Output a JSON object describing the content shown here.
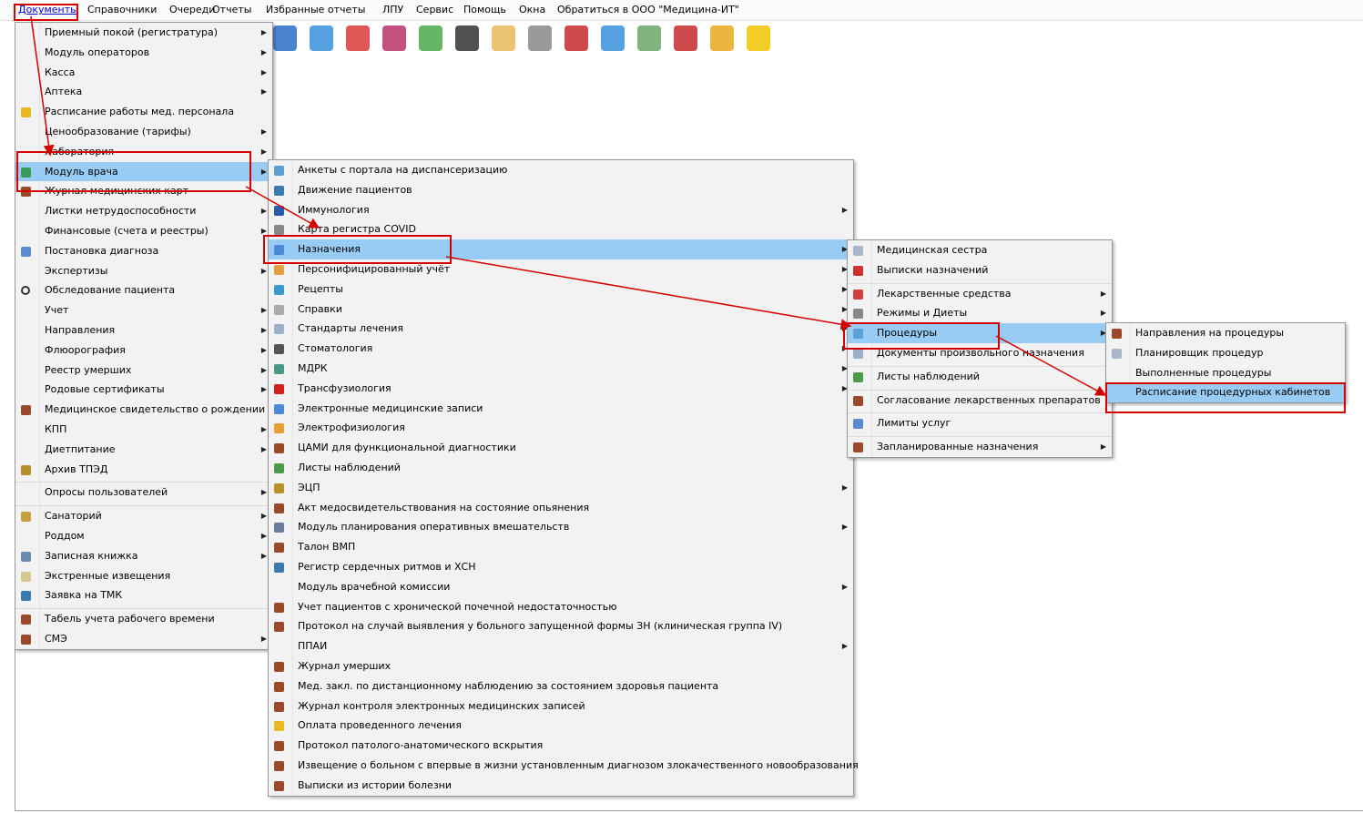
{
  "menubar": {
    "items": [
      "Документы",
      "Справочники",
      "Очереди",
      "Отчеты",
      "Избранные отчеты",
      "ЛПУ",
      "Сервис",
      "Помощь",
      "Окна",
      "Обратиться в ООО \"Медицина-ИТ\""
    ],
    "active": "Документы"
  },
  "toolbar": {
    "icons": [
      "clock-icon",
      "medicine-icon",
      "medkit-icon",
      "cubes-icon",
      "recycle-icon",
      "barcode-icon",
      "doctor-icon",
      "syringe-icon",
      "book-icon",
      "calendar-icon",
      "document-icon",
      "record-icon",
      "lock-icon",
      "chat-icon"
    ]
  },
  "menu1": {
    "items": [
      {
        "label": "Приемный покой (регистратура)",
        "submenu": true,
        "icon": ""
      },
      {
        "label": "Модуль операторов",
        "submenu": true,
        "icon": ""
      },
      {
        "label": "Касса",
        "submenu": true,
        "icon": ""
      },
      {
        "label": "Аптека",
        "submenu": true,
        "icon": ""
      },
      {
        "label": "Расписание работы мед. персонала",
        "submenu": false,
        "icon": "schedule-icon"
      },
      {
        "label": "Ценообразование (тарифы)",
        "submenu": true,
        "icon": ""
      },
      {
        "label": "Лаборатория",
        "submenu": true,
        "icon": ""
      },
      {
        "label": "Модуль врача",
        "submenu": true,
        "icon": "doctor-icon",
        "highlight": true
      },
      {
        "label": "Журнал медицинских карт",
        "submenu": false,
        "icon": "journal-icon"
      },
      {
        "label": "Листки нетрудоспособности",
        "submenu": true,
        "icon": ""
      },
      {
        "label": "Финансовые (счета и реестры)",
        "submenu": true,
        "icon": ""
      },
      {
        "label": "Постановка диагноза",
        "submenu": false,
        "icon": "diagnosis-icon"
      },
      {
        "label": "Экспертизы",
        "submenu": true,
        "icon": ""
      },
      {
        "label": "Обследование пациента",
        "submenu": false,
        "icon": "search-icon"
      },
      {
        "label": "Учет",
        "submenu": true,
        "icon": ""
      },
      {
        "label": "Направления",
        "submenu": true,
        "icon": ""
      },
      {
        "label": "Флюорография",
        "submenu": true,
        "icon": ""
      },
      {
        "label": "Реестр умерших",
        "submenu": true,
        "icon": ""
      },
      {
        "label": "Родовые сертификаты",
        "submenu": true,
        "icon": ""
      },
      {
        "label": "Медицинское свидетельство о рождении",
        "submenu": false,
        "icon": "journal-icon"
      },
      {
        "label": "КПП",
        "submenu": true,
        "icon": ""
      },
      {
        "label": "Диетпитание",
        "submenu": true,
        "icon": ""
      },
      {
        "label": "Архив ТПЭД",
        "submenu": false,
        "icon": "archive-icon"
      },
      {
        "label": "Опросы пользователей",
        "submenu": true,
        "icon": "",
        "sep": true
      },
      {
        "label": "Санаторий",
        "submenu": true,
        "icon": "home-icon",
        "sep": true
      },
      {
        "label": "Роддом",
        "submenu": true,
        "icon": ""
      },
      {
        "label": "Записная книжка",
        "submenu": true,
        "icon": "notebook-icon"
      },
      {
        "label": "Экстренные извещения",
        "submenu": false,
        "icon": "notice-icon"
      },
      {
        "label": "Заявка на ТМК",
        "submenu": false,
        "icon": "people-icon"
      },
      {
        "label": "Табель учета рабочего времени",
        "submenu": false,
        "icon": "journal-icon",
        "sep": true
      },
      {
        "label": "СМЭ",
        "submenu": true,
        "icon": "journal-icon"
      }
    ]
  },
  "menu2": {
    "items": [
      {
        "label": "Анкеты с портала на диспансеризацию",
        "submenu": false,
        "icon": "form-icon"
      },
      {
        "label": "Движение пациентов",
        "submenu": false,
        "icon": "people-icon"
      },
      {
        "label": "Иммунология",
        "submenu": true,
        "icon": "syringe-icon"
      },
      {
        "label": "Карта регистра COVID",
        "submenu": false,
        "icon": "clipboard-icon"
      },
      {
        "label": "Назначения",
        "submenu": true,
        "icon": "note-icon",
        "highlight": true
      },
      {
        "label": "Персонифицированный учёт",
        "submenu": true,
        "icon": "person-icon"
      },
      {
        "label": "Рецепты",
        "submenu": true,
        "icon": "prescription-icon"
      },
      {
        "label": "Справки",
        "submenu": true,
        "icon": "doc-icon"
      },
      {
        "label": "Стандарты лечения",
        "submenu": true,
        "icon": "list-icon"
      },
      {
        "label": "Стоматология",
        "submenu": true,
        "icon": "tooth-icon"
      },
      {
        "label": "МДРК",
        "submenu": true,
        "icon": "group-icon"
      },
      {
        "label": "Трансфузиология",
        "submenu": true,
        "icon": "blood-icon"
      },
      {
        "label": "Электронные медицинские записи",
        "submenu": false,
        "icon": "note-icon"
      },
      {
        "label": "Электрофизиология",
        "submenu": false,
        "icon": "chart-icon"
      },
      {
        "label": "ЦАМИ для функциональной диагностики",
        "submenu": false,
        "icon": "journal-icon"
      },
      {
        "label": "Листы наблюдений",
        "submenu": false,
        "icon": "sheet-icon"
      },
      {
        "label": "ЭЦП",
        "submenu": true,
        "icon": "archive-icon"
      },
      {
        "label": "Акт медосвидетельствования на состояние опьянения",
        "submenu": false,
        "icon": "journal-icon"
      },
      {
        "label": "Модуль планирования оперативных вмешательств",
        "submenu": true,
        "icon": "plan-icon"
      },
      {
        "label": "Талон ВМП",
        "submenu": false,
        "icon": "journal-icon"
      },
      {
        "label": "Регистр сердечных ритмов и ХСН",
        "submenu": false,
        "icon": "people-icon"
      },
      {
        "label": "Модуль врачебной комиссии",
        "submenu": true,
        "icon": ""
      },
      {
        "label": "Учет пациентов с хронической почечной недостаточностью",
        "submenu": false,
        "icon": "journal-icon"
      },
      {
        "label": "Протокол на случай выявления у больного запущенной формы ЗН (клиническая группа IV)",
        "submenu": false,
        "icon": "journal-icon"
      },
      {
        "label": "ППАИ",
        "submenu": true,
        "icon": ""
      },
      {
        "label": "Журнал умерших",
        "submenu": false,
        "icon": "journal-icon"
      },
      {
        "label": "Мед. закл. по дистанционному наблюдению за состоянием здоровья пациента",
        "submenu": false,
        "icon": "journal-icon"
      },
      {
        "label": "Журнал контроля электронных медицинских записей",
        "submenu": false,
        "icon": "journal-icon"
      },
      {
        "label": "Оплата проведенного лечения",
        "submenu": false,
        "icon": "coins-icon"
      },
      {
        "label": "Протокол патолого-анатомического вскрытия",
        "submenu": false,
        "icon": "journal-icon"
      },
      {
        "label": "Извещение о больном с впервые в жизни установленным диагнозом злокачественного новообразования",
        "submenu": false,
        "icon": "journal-icon"
      },
      {
        "label": "Выписки из истории болезни",
        "submenu": false,
        "icon": "journal-icon"
      }
    ]
  },
  "menu3": {
    "items": [
      {
        "label": "Медицинская сестра",
        "submenu": false,
        "icon": "nurse-icon"
      },
      {
        "label": "Выписки назначений",
        "submenu": false,
        "icon": "pill-icon"
      },
      {
        "label": "Лекарственные средства",
        "submenu": true,
        "icon": "capsule-icon",
        "sep": true
      },
      {
        "label": "Режимы и Диеты",
        "submenu": true,
        "icon": "clipboard-icon"
      },
      {
        "label": "Процедуры",
        "submenu": true,
        "icon": "procedure-icon",
        "highlight": true
      },
      {
        "label": "Документы произвольного назначения",
        "submenu": false,
        "icon": "list-icon"
      },
      {
        "label": "Листы наблюдений",
        "submenu": false,
        "icon": "sheet-icon",
        "sep": true
      },
      {
        "label": "Согласование лекарственных препаратов",
        "submenu": false,
        "icon": "journal-icon",
        "sep": true
      },
      {
        "label": "Лимиты услуг",
        "submenu": false,
        "icon": "table-icon",
        "sep": true
      },
      {
        "label": "Запланированные назначения",
        "submenu": true,
        "icon": "journal-icon",
        "sep": true
      }
    ]
  },
  "menu4": {
    "items": [
      {
        "label": "Направления на процедуры",
        "submenu": false,
        "icon": "journal-icon"
      },
      {
        "label": "Планировщик процедур",
        "submenu": false,
        "icon": "nurse-icon"
      },
      {
        "label": "Выполненные процедуры",
        "submenu": false,
        "icon": ""
      },
      {
        "label": "Расписание процедурных кабинетов",
        "submenu": false,
        "icon": "",
        "highlight": true
      }
    ]
  },
  "colors": {
    "highlight": "#99ccf5",
    "annotation": "#d40000",
    "menu_bg": "#f2f2f2"
  }
}
